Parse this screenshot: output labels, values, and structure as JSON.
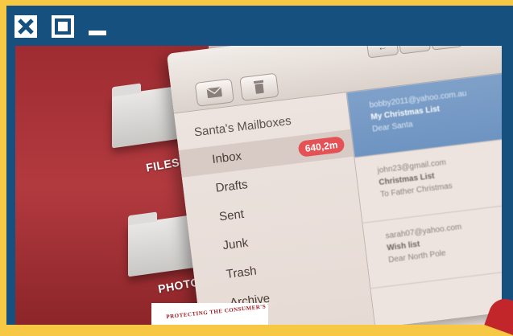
{
  "window_controls": {
    "close_icon": "close-icon",
    "maximize_icon": "maximize-icon",
    "minimize_icon": "minimize-icon"
  },
  "folders": [
    {
      "label": "FILES"
    },
    {
      "label": "PHOTO"
    }
  ],
  "mail_app": {
    "toolbar": {
      "compose_icon": "envelope-icon",
      "delete_icon": "trash-icon",
      "nav": [
        "←",
        "«",
        "»"
      ]
    },
    "sidebar": {
      "header": "Santa's Mailboxes",
      "items": [
        {
          "label": "Inbox",
          "badge": "640,2m",
          "selected": true
        },
        {
          "label": "Drafts"
        },
        {
          "label": "Sent"
        },
        {
          "label": "Junk"
        },
        {
          "label": "Trash"
        },
        {
          "label": "Archive"
        }
      ]
    },
    "messages": [
      {
        "from": "bobby2011@yahoo.com.au",
        "subject": "My Christmas List",
        "preview": "Dear Santa",
        "selected": true
      },
      {
        "from": "john23@gmail.com",
        "subject": "Christmas List",
        "preview": "To Father Christmas"
      },
      {
        "from": "sarah07@yahoo.com",
        "subject": "Wish list",
        "preview": "Dear North Pole"
      }
    ]
  },
  "stamp": {
    "text": "PROTECTING THE CONSUMER'S FUTURE"
  },
  "colors": {
    "border": "#f6c843",
    "frame": "#15507f",
    "badge": "#e45256",
    "selected_message": "#6e94c2"
  }
}
